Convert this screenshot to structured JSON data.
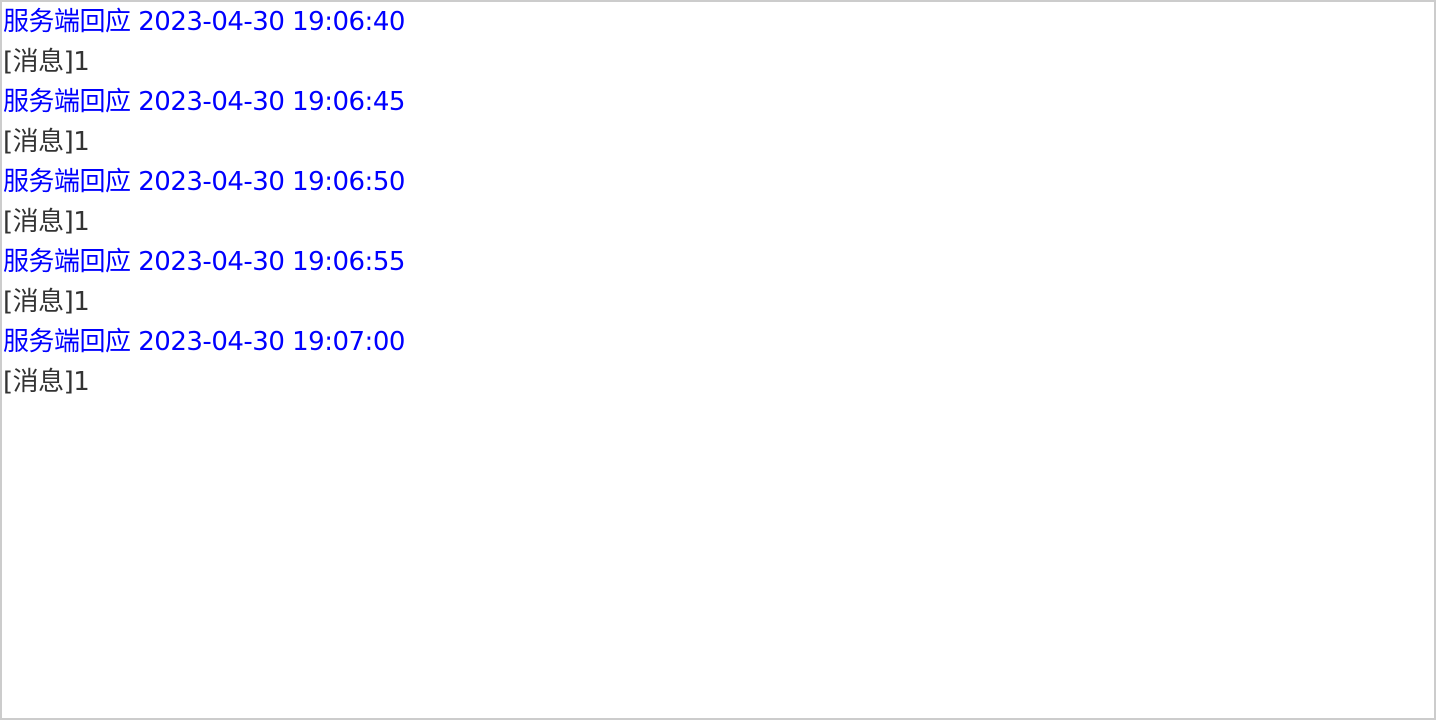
{
  "colors": {
    "server": "#0000ff",
    "message": "#333333",
    "border": "#cccccc"
  },
  "log": [
    {
      "server": "服务端回应 2023-04-30 19:06:40",
      "message": "[消息]1"
    },
    {
      "server": "服务端回应 2023-04-30 19:06:45",
      "message": "[消息]1"
    },
    {
      "server": "服务端回应 2023-04-30 19:06:50",
      "message": "[消息]1"
    },
    {
      "server": "服务端回应 2023-04-30 19:06:55",
      "message": "[消息]1"
    },
    {
      "server": "服务端回应 2023-04-30 19:07:00",
      "message": "[消息]1"
    }
  ]
}
